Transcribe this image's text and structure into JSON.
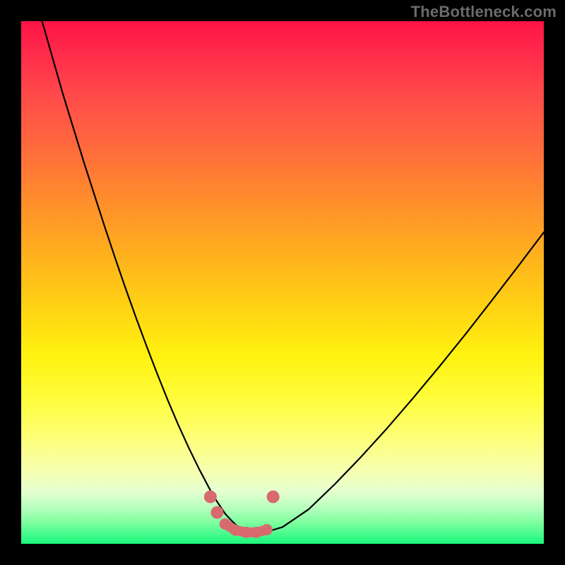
{
  "watermark": "TheBottleneck.com",
  "colors": {
    "background": "#000000",
    "curve_stroke": "#000000",
    "marker_fill": "#d86a6f",
    "marker_stroke": "#d86a6f"
  },
  "chart_data": {
    "type": "line",
    "title": "",
    "xlabel": "",
    "ylabel": "",
    "xlim": [
      0,
      100
    ],
    "ylim": [
      0,
      100
    ],
    "grid": false,
    "legend": false,
    "series": [
      {
        "name": "bottleneck-curve",
        "x": [
          4,
          6,
          8,
          10,
          12,
          14,
          16,
          18,
          20,
          22,
          24,
          26,
          28,
          30,
          32,
          34,
          36,
          37,
          38,
          39,
          40,
          41,
          42,
          43,
          44,
          46,
          50,
          55,
          60,
          65,
          70,
          75,
          80,
          85,
          90,
          95,
          100
        ],
        "values": [
          100,
          93,
          86,
          79.5,
          73,
          66.8,
          60.6,
          54.6,
          48.8,
          43.2,
          37.8,
          32.6,
          27.6,
          22.9,
          18.5,
          14.4,
          10.6,
          8.8,
          7.3,
          5.8,
          4.7,
          3.7,
          3.0,
          2.4,
          2.1,
          2.0,
          3.2,
          6.6,
          11.4,
          16.6,
          22.1,
          27.9,
          33.9,
          40.1,
          46.5,
          53.0,
          59.6
        ]
      }
    ],
    "markers": [
      {
        "name": "range-left-top",
        "x": 36.2,
        "y": 9.0
      },
      {
        "name": "range-left-mid",
        "x": 37.5,
        "y": 6.0
      },
      {
        "name": "range-left-bottom",
        "x": 39.0,
        "y": 3.8
      },
      {
        "name": "range-flat-a",
        "x": 41.0,
        "y": 2.6
      },
      {
        "name": "range-flat-b",
        "x": 43.0,
        "y": 2.2
      },
      {
        "name": "range-flat-c",
        "x": 45.0,
        "y": 2.2
      },
      {
        "name": "range-right-bottom",
        "x": 47.0,
        "y": 2.7
      },
      {
        "name": "range-right-top",
        "x": 48.2,
        "y": 9.0
      }
    ]
  }
}
